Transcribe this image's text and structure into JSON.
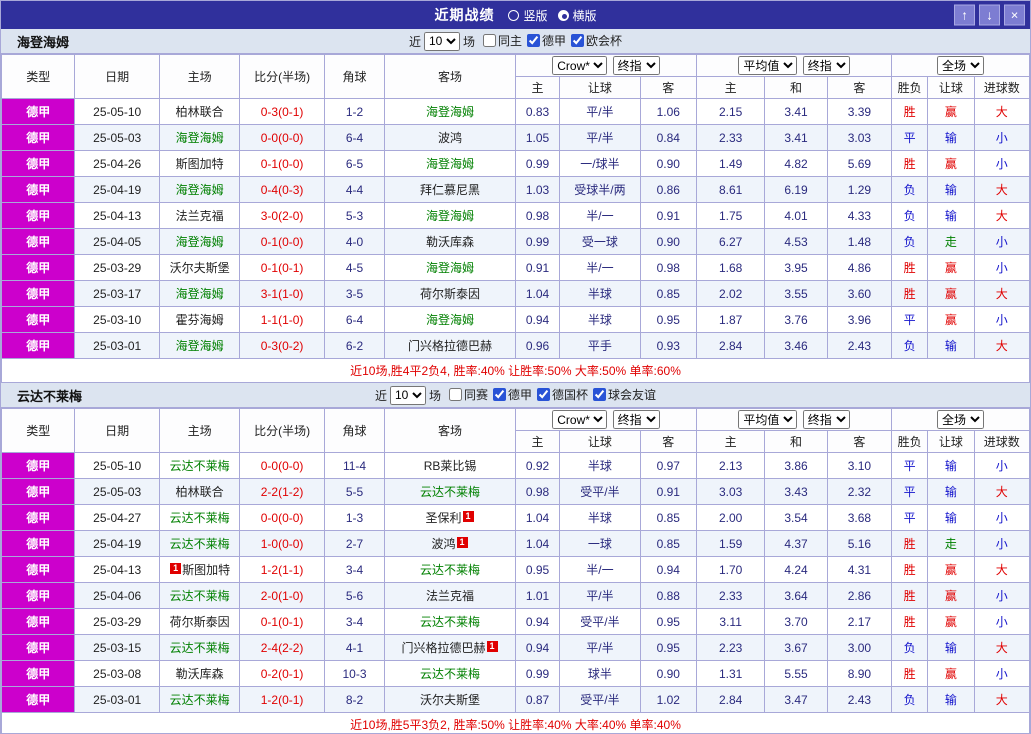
{
  "header": {
    "title": "近期战绩",
    "view_options": [
      {
        "label": "竖版",
        "checked": false
      },
      {
        "label": "横版",
        "checked": true
      }
    ],
    "buttons": {
      "up": "↑",
      "down": "↓",
      "close": "×"
    }
  },
  "filter_common": {
    "near": "近",
    "count": "10",
    "matches": "场"
  },
  "selects": {
    "bookmaker": "Crow*",
    "final_index": "终指",
    "average": "平均值",
    "final_index2": "终指",
    "full_match": "全场"
  },
  "columns": {
    "type": "类型",
    "date": "日期",
    "home": "主场",
    "score": "比分(半场)",
    "corners": "角球",
    "away": "客场",
    "ah_home": "主",
    "ah_line": "让球",
    "ah_away": "客",
    "eu_home": "主",
    "eu_draw": "和",
    "eu_away": "客",
    "result": "胜负",
    "handicap": "让球",
    "goals": "进球数"
  },
  "colors": {
    "titlebar-bg": "#30309c",
    "section-bar-bg": "#dce4f0",
    "grid": "#a8a8d8",
    "league-bg": "#cc00cc",
    "row-alt-bg": "#eff4fb",
    "team-green": "#008000",
    "score-red": "#e00000",
    "num-navy": "#2a2a7e",
    "result-win": "#e00000",
    "result-draw": "#1414cc",
    "result-loss": "#1414cc",
    "handicap-win": "#e00000",
    "handicap-push": "#008000",
    "handicap-loss": "#1414cc",
    "goals-over": "#e00000",
    "goals-under": "#1414cc",
    "summary-red": "#e00000",
    "badge-red": "#e00000"
  },
  "sections": [
    {
      "team": "海登海姆",
      "filters": [
        {
          "label": "同主",
          "checked": false
        },
        {
          "label": "德甲",
          "checked": true
        },
        {
          "label": "欧会杯",
          "checked": true
        }
      ],
      "rows": [
        {
          "league": "德甲",
          "date": "25-05-10",
          "home": "柏林联合",
          "home_team": false,
          "score": "0-3(0-1)",
          "corners": "1-2",
          "away": "海登海姆",
          "away_team": true,
          "ah": [
            "0.83",
            "平/半",
            "1.06"
          ],
          "eu": [
            "2.15",
            "3.41",
            "3.39"
          ],
          "result": "胜",
          "handicap": "赢",
          "goals": "大"
        },
        {
          "league": "德甲",
          "date": "25-05-03",
          "home": "海登海姆",
          "home_team": true,
          "score": "0-0(0-0)",
          "corners": "6-4",
          "away": "波鸿",
          "away_team": false,
          "ah": [
            "1.05",
            "平/半",
            "0.84"
          ],
          "eu": [
            "2.33",
            "3.41",
            "3.03"
          ],
          "result": "平",
          "handicap": "输",
          "goals": "小"
        },
        {
          "league": "德甲",
          "date": "25-04-26",
          "home": "斯图加特",
          "home_team": false,
          "score": "0-1(0-0)",
          "corners": "6-5",
          "away": "海登海姆",
          "away_team": true,
          "ah": [
            "0.99",
            "一/球半",
            "0.90"
          ],
          "eu": [
            "1.49",
            "4.82",
            "5.69"
          ],
          "result": "胜",
          "handicap": "赢",
          "goals": "小"
        },
        {
          "league": "德甲",
          "date": "25-04-19",
          "home": "海登海姆",
          "home_team": true,
          "score": "0-4(0-3)",
          "corners": "4-4",
          "away": "拜仁慕尼黑",
          "away_team": false,
          "ah": [
            "1.03",
            "受球半/两",
            "0.86"
          ],
          "eu": [
            "8.61",
            "6.19",
            "1.29"
          ],
          "result": "负",
          "handicap": "输",
          "goals": "大"
        },
        {
          "league": "德甲",
          "date": "25-04-13",
          "home": "法兰克福",
          "home_team": false,
          "score": "3-0(2-0)",
          "corners": "5-3",
          "away": "海登海姆",
          "away_team": true,
          "ah": [
            "0.98",
            "半/一",
            "0.91"
          ],
          "eu": [
            "1.75",
            "4.01",
            "4.33"
          ],
          "result": "负",
          "handicap": "输",
          "goals": "大"
        },
        {
          "league": "德甲",
          "date": "25-04-05",
          "home": "海登海姆",
          "home_team": true,
          "score": "0-1(0-0)",
          "corners": "4-0",
          "away": "勒沃库森",
          "away_team": false,
          "ah": [
            "0.99",
            "受一球",
            "0.90"
          ],
          "eu": [
            "6.27",
            "4.53",
            "1.48"
          ],
          "result": "负",
          "handicap": "走",
          "goals": "小"
        },
        {
          "league": "德甲",
          "date": "25-03-29",
          "home": "沃尔夫斯堡",
          "home_team": false,
          "score": "0-1(0-1)",
          "corners": "4-5",
          "away": "海登海姆",
          "away_team": true,
          "ah": [
            "0.91",
            "半/一",
            "0.98"
          ],
          "eu": [
            "1.68",
            "3.95",
            "4.86"
          ],
          "result": "胜",
          "handicap": "赢",
          "goals": "小"
        },
        {
          "league": "德甲",
          "date": "25-03-17",
          "home": "海登海姆",
          "home_team": true,
          "score": "3-1(1-0)",
          "corners": "3-5",
          "away": "荷尔斯泰因",
          "away_team": false,
          "ah": [
            "1.04",
            "半球",
            "0.85"
          ],
          "eu": [
            "2.02",
            "3.55",
            "3.60"
          ],
          "result": "胜",
          "handicap": "赢",
          "goals": "大"
        },
        {
          "league": "德甲",
          "date": "25-03-10",
          "home": "霍芬海姆",
          "home_team": false,
          "score": "1-1(1-0)",
          "corners": "6-4",
          "away": "海登海姆",
          "away_team": true,
          "ah": [
            "0.94",
            "半球",
            "0.95"
          ],
          "eu": [
            "1.87",
            "3.76",
            "3.96"
          ],
          "result": "平",
          "handicap": "赢",
          "goals": "小"
        },
        {
          "league": "德甲",
          "date": "25-03-01",
          "home": "海登海姆",
          "home_team": true,
          "score": "0-3(0-2)",
          "corners": "6-2",
          "away": "门兴格拉德巴赫",
          "away_team": false,
          "ah": [
            "0.96",
            "平手",
            "0.93"
          ],
          "eu": [
            "2.84",
            "3.46",
            "2.43"
          ],
          "result": "负",
          "handicap": "输",
          "goals": "大"
        }
      ],
      "summary": "近10场,胜4平2负4, 胜率:40% 让胜率:50% 大率:50% 单率:60%"
    },
    {
      "team": "云达不莱梅",
      "filters": [
        {
          "label": "同赛",
          "checked": false
        },
        {
          "label": "德甲",
          "checked": true
        },
        {
          "label": "德国杯",
          "checked": true
        },
        {
          "label": "球会友谊",
          "checked": true
        }
      ],
      "rows": [
        {
          "league": "德甲",
          "date": "25-05-10",
          "home": "云达不莱梅",
          "home_team": true,
          "score": "0-0(0-0)",
          "corners": "11-4",
          "away": "RB莱比锡",
          "away_team": false,
          "ah": [
            "0.92",
            "半球",
            "0.97"
          ],
          "eu": [
            "2.13",
            "3.86",
            "3.10"
          ],
          "result": "平",
          "handicap": "输",
          "goals": "小"
        },
        {
          "league": "德甲",
          "date": "25-05-03",
          "home": "柏林联合",
          "home_team": false,
          "score": "2-2(1-2)",
          "corners": "5-5",
          "away": "云达不莱梅",
          "away_team": true,
          "ah": [
            "0.98",
            "受平/半",
            "0.91"
          ],
          "eu": [
            "3.03",
            "3.43",
            "2.32"
          ],
          "result": "平",
          "handicap": "输",
          "goals": "大"
        },
        {
          "league": "德甲",
          "date": "25-04-27",
          "home": "云达不莱梅",
          "home_team": true,
          "score": "0-0(0-0)",
          "corners": "1-3",
          "away": "圣保利",
          "away_team": false,
          "away_badge": "1",
          "ah": [
            "1.04",
            "半球",
            "0.85"
          ],
          "eu": [
            "2.00",
            "3.54",
            "3.68"
          ],
          "result": "平",
          "handicap": "输",
          "goals": "小"
        },
        {
          "league": "德甲",
          "date": "25-04-19",
          "home": "云达不莱梅",
          "home_team": true,
          "score": "1-0(0-0)",
          "corners": "2-7",
          "away": "波鸿",
          "away_team": false,
          "away_badge": "1",
          "ah": [
            "1.04",
            "一球",
            "0.85"
          ],
          "eu": [
            "1.59",
            "4.37",
            "5.16"
          ],
          "result": "胜",
          "handicap": "走",
          "goals": "小"
        },
        {
          "league": "德甲",
          "date": "25-04-13",
          "home": "斯图加特",
          "home_team": false,
          "home_badge": "1",
          "home_badge_pos": "before",
          "score": "1-2(1-1)",
          "corners": "3-4",
          "away": "云达不莱梅",
          "away_team": true,
          "ah": [
            "0.95",
            "半/一",
            "0.94"
          ],
          "eu": [
            "1.70",
            "4.24",
            "4.31"
          ],
          "result": "胜",
          "handicap": "赢",
          "goals": "大"
        },
        {
          "league": "德甲",
          "date": "25-04-06",
          "home": "云达不莱梅",
          "home_team": true,
          "score": "2-0(1-0)",
          "corners": "5-6",
          "away": "法兰克福",
          "away_team": false,
          "ah": [
            "1.01",
            "平/半",
            "0.88"
          ],
          "eu": [
            "2.33",
            "3.64",
            "2.86"
          ],
          "result": "胜",
          "handicap": "赢",
          "goals": "小"
        },
        {
          "league": "德甲",
          "date": "25-03-29",
          "home": "荷尔斯泰因",
          "home_team": false,
          "score": "0-1(0-1)",
          "corners": "3-4",
          "away": "云达不莱梅",
          "away_team": true,
          "ah": [
            "0.94",
            "受平/半",
            "0.95"
          ],
          "eu": [
            "3.11",
            "3.70",
            "2.17"
          ],
          "result": "胜",
          "handicap": "赢",
          "goals": "小"
        },
        {
          "league": "德甲",
          "date": "25-03-15",
          "home": "云达不莱梅",
          "home_team": true,
          "score": "2-4(2-2)",
          "corners": "4-1",
          "away": "门兴格拉德巴赫",
          "away_team": false,
          "away_badge": "1",
          "ah": [
            "0.94",
            "平/半",
            "0.95"
          ],
          "eu": [
            "2.23",
            "3.67",
            "3.00"
          ],
          "result": "负",
          "handicap": "输",
          "goals": "大"
        },
        {
          "league": "德甲",
          "date": "25-03-08",
          "home": "勒沃库森",
          "home_team": false,
          "score": "0-2(0-1)",
          "corners": "10-3",
          "away": "云达不莱梅",
          "away_team": true,
          "ah": [
            "0.99",
            "球半",
            "0.90"
          ],
          "eu": [
            "1.31",
            "5.55",
            "8.90"
          ],
          "result": "胜",
          "handicap": "赢",
          "goals": "小"
        },
        {
          "league": "德甲",
          "date": "25-03-01",
          "home": "云达不莱梅",
          "home_team": true,
          "score": "1-2(0-1)",
          "corners": "8-2",
          "away": "沃尔夫斯堡",
          "away_team": false,
          "ah": [
            "0.87",
            "受平/半",
            "1.02"
          ],
          "eu": [
            "2.84",
            "3.47",
            "2.43"
          ],
          "result": "负",
          "handicap": "输",
          "goals": "大"
        }
      ],
      "summary": "近10场,胜5平3负2, 胜率:50% 让胜率:40% 大率:40% 单率:40%"
    }
  ]
}
